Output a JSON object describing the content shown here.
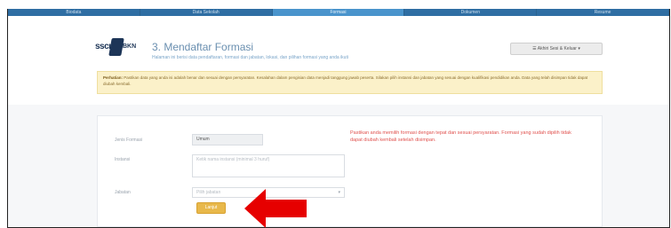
{
  "nav": {
    "tabs": [
      {
        "label": "Biodata"
      },
      {
        "label": "Data Sekolah"
      },
      {
        "label": "Formasi",
        "active": true
      },
      {
        "label": "Dokumen"
      },
      {
        "label": "Resume"
      }
    ]
  },
  "header": {
    "logo_left": "sscn",
    "logo_right": "BKN",
    "step_title": "3. Mendaftar Formasi",
    "step_subtitle": "Halaman ini berisi data pendaftaran, formasi dan jabatan, lokasi, dan pilihan formasi yang anda ikuti",
    "account_button": "☰ Akhiri Sesi & Keluar ▾"
  },
  "notice": {
    "label": "Perhatian:",
    "text": "Pastikan data yang anda isi adalah benar dan sesuai dengan persyaratan. Kesalahan dalam pengisian data menjadi tanggung jawab peserta. Silakan pilih instansi dan jabatan yang sesuai dengan kualifikasi pendidikan anda. Data yang telah disimpan tidak dapat diubah kembali."
  },
  "form": {
    "labels": {
      "jenis_formasi": "Jenis Formasi",
      "instansi": "Instansi",
      "jabatan": "Jabatan"
    },
    "jenis_formasi_value": "Umum",
    "instansi_placeholder": "Ketik nama instansi (minimal 3 huruf)",
    "jabatan_placeholder": "Pilih jabatan",
    "next_button": "Lanjut"
  },
  "warning": "Pastikan anda memilih formasi dengan tepat dan sesuai persyaratan. Formasi yang sudah dipilih tidak dapat diubah kembali setelah disimpan.",
  "colors": {
    "nav": "#2f6ea3",
    "accent_button": "#e8b84a",
    "warning_text": "#e0524f",
    "arrow": "#e60000"
  }
}
